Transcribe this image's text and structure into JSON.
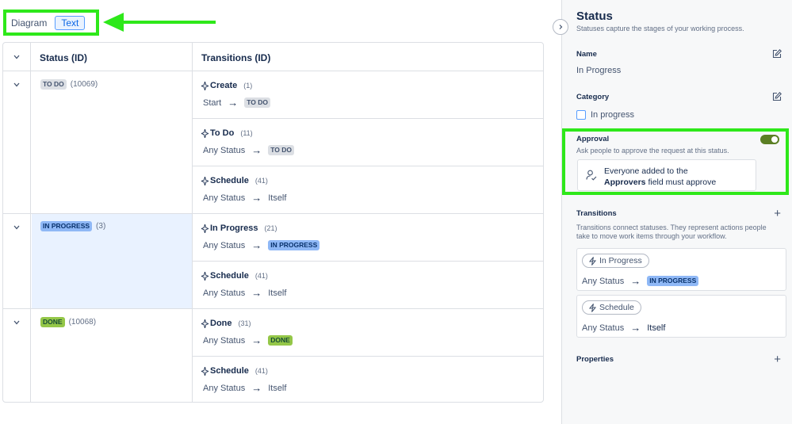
{
  "view_toggle": {
    "diagram": "Diagram",
    "text": "Text"
  },
  "table": {
    "col_status": "Status (ID)",
    "col_transitions": "Transitions (ID)",
    "groups": [
      {
        "status": "TO DO",
        "status_id": "(10069)"
      },
      {
        "status": "IN PROGRESS",
        "status_id": "(3)"
      },
      {
        "status": "DONE",
        "status_id": "(10068)"
      }
    ],
    "transitions": [
      {
        "name": "Create",
        "id": "(1)",
        "from": "Start",
        "to": "TO DO"
      },
      {
        "name": "To Do",
        "id": "(11)",
        "from": "Any Status",
        "to": "TO DO"
      },
      {
        "name": "Schedule",
        "id": "(41)",
        "from": "Any Status",
        "to": "Itself"
      },
      {
        "name": "In Progress",
        "id": "(21)",
        "from": "Any Status",
        "to": "IN PROGRESS"
      },
      {
        "name": "Schedule",
        "id": "(41)",
        "from": "Any Status",
        "to": "Itself"
      },
      {
        "name": "Done",
        "id": "(31)",
        "from": "Any Status",
        "to": "DONE"
      },
      {
        "name": "Schedule",
        "id": "(41)",
        "from": "Any Status",
        "to": "Itself"
      }
    ]
  },
  "panel": {
    "title": "Status",
    "subtitle": "Statuses capture the stages of your working process.",
    "name_label": "Name",
    "name_value": "In Progress",
    "category_label": "Category",
    "category_value": "In progress",
    "approval_label": "Approval",
    "approval_desc": "Ask people to approve the request at this status.",
    "approval_enabled": true,
    "approval_card_pre": "Everyone added to the",
    "approval_card_bold": "Approvers",
    "approval_card_post": "field must approve",
    "transitions_label": "Transitions",
    "transitions_desc_1": "Transitions connect statuses. They represent actions people",
    "transitions_desc_2": "take to move work items through your workflow.",
    "transition_cards": [
      {
        "name": "In Progress",
        "from": "Any Status",
        "to": "IN PROGRESS"
      },
      {
        "name": "Schedule",
        "from": "Any Status",
        "to": "Itself"
      }
    ],
    "properties_label": "Properties"
  },
  "colors": {
    "annotation": "#2ee81a",
    "accent": "#0c66e4",
    "toggle_on": "#5b7f24"
  },
  "icons": [
    "chevron-down-icon",
    "sparkle-icon",
    "arrow-right-icon",
    "edit-icon",
    "plus-icon",
    "chevron-right-icon",
    "person-check-icon",
    "lightning-icon"
  ]
}
